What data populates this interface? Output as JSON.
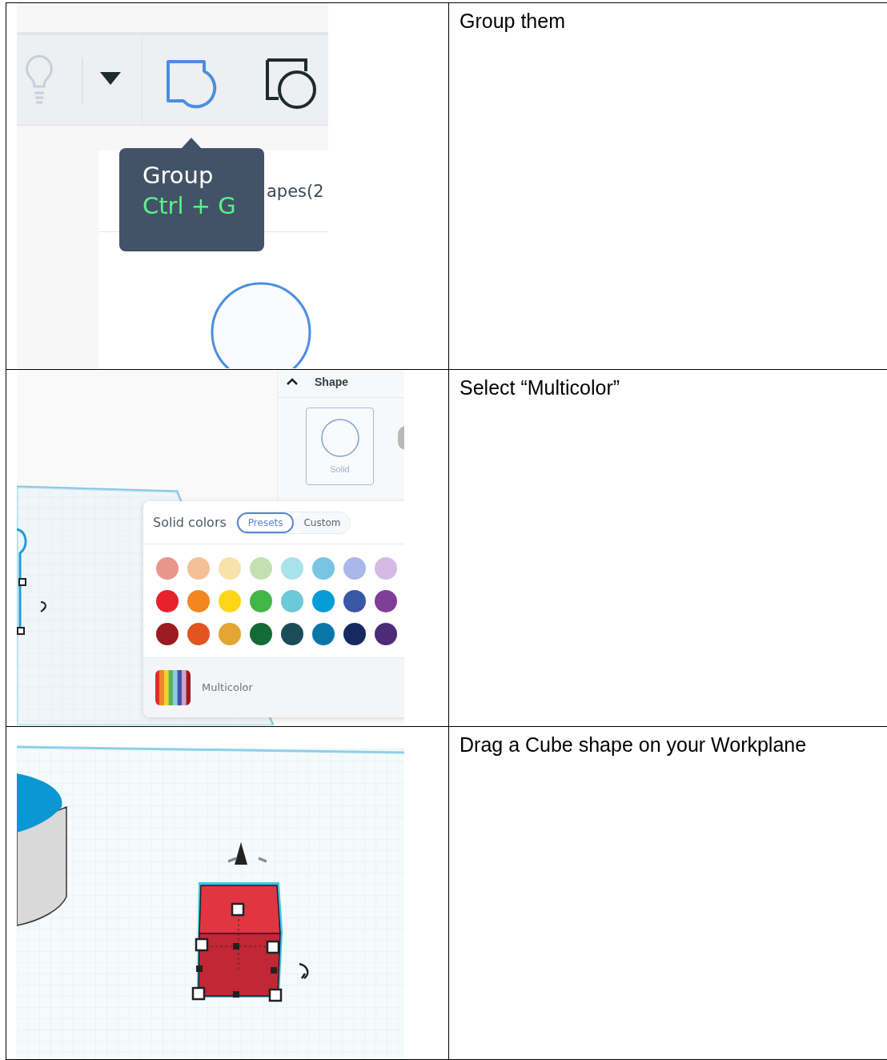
{
  "rows": [
    {
      "kind": "group",
      "screenshot": {
        "tooltip": {
          "title": "Group",
          "shortcut": "Ctrl + G"
        },
        "panel_title": "apes(2"
      },
      "instruction": "Group them"
    },
    {
      "kind": "colors",
      "screenshot": {
        "section": "Shape",
        "shape_option": "Solid",
        "popup_title": "Solid colors",
        "tabs": [
          {
            "label": "Presets",
            "selected": true
          },
          {
            "label": "Custom",
            "selected": false
          }
        ],
        "swatches": [
          {
            "color": "#e8968b"
          },
          {
            "color": "#f5c097"
          },
          {
            "color": "#f6e2aa"
          },
          {
            "color": "#c5e0b0"
          },
          {
            "color": "#a8e3ec"
          },
          {
            "color": "#79c4e0"
          },
          {
            "color": "#a9b8ea"
          },
          {
            "color": "#d5bbe4"
          },
          {
            "color": "#e8212e"
          },
          {
            "color": "#f3861f"
          },
          {
            "color": "#fdd716"
          },
          {
            "color": "#43b649"
          },
          {
            "color": "#6ccad8"
          },
          {
            "color": "#079cd6"
          },
          {
            "color": "#3a57a6"
          },
          {
            "color": "#7f3f99"
          },
          {
            "color": "#9b1b22"
          },
          {
            "color": "#e1541f"
          },
          {
            "color": "#e3a630"
          },
          {
            "color": "#136b35"
          },
          {
            "color": "#1b4d59"
          },
          {
            "color": "#0b77a8"
          },
          {
            "color": "#152a61"
          },
          {
            "color": "#4c2c76"
          }
        ],
        "multicolor": "Multicolor"
      },
      "instruction": "Select “Multicolor”"
    },
    {
      "kind": "workplane",
      "instruction": "Drag a Cube shape on your Workplane"
    }
  ]
}
